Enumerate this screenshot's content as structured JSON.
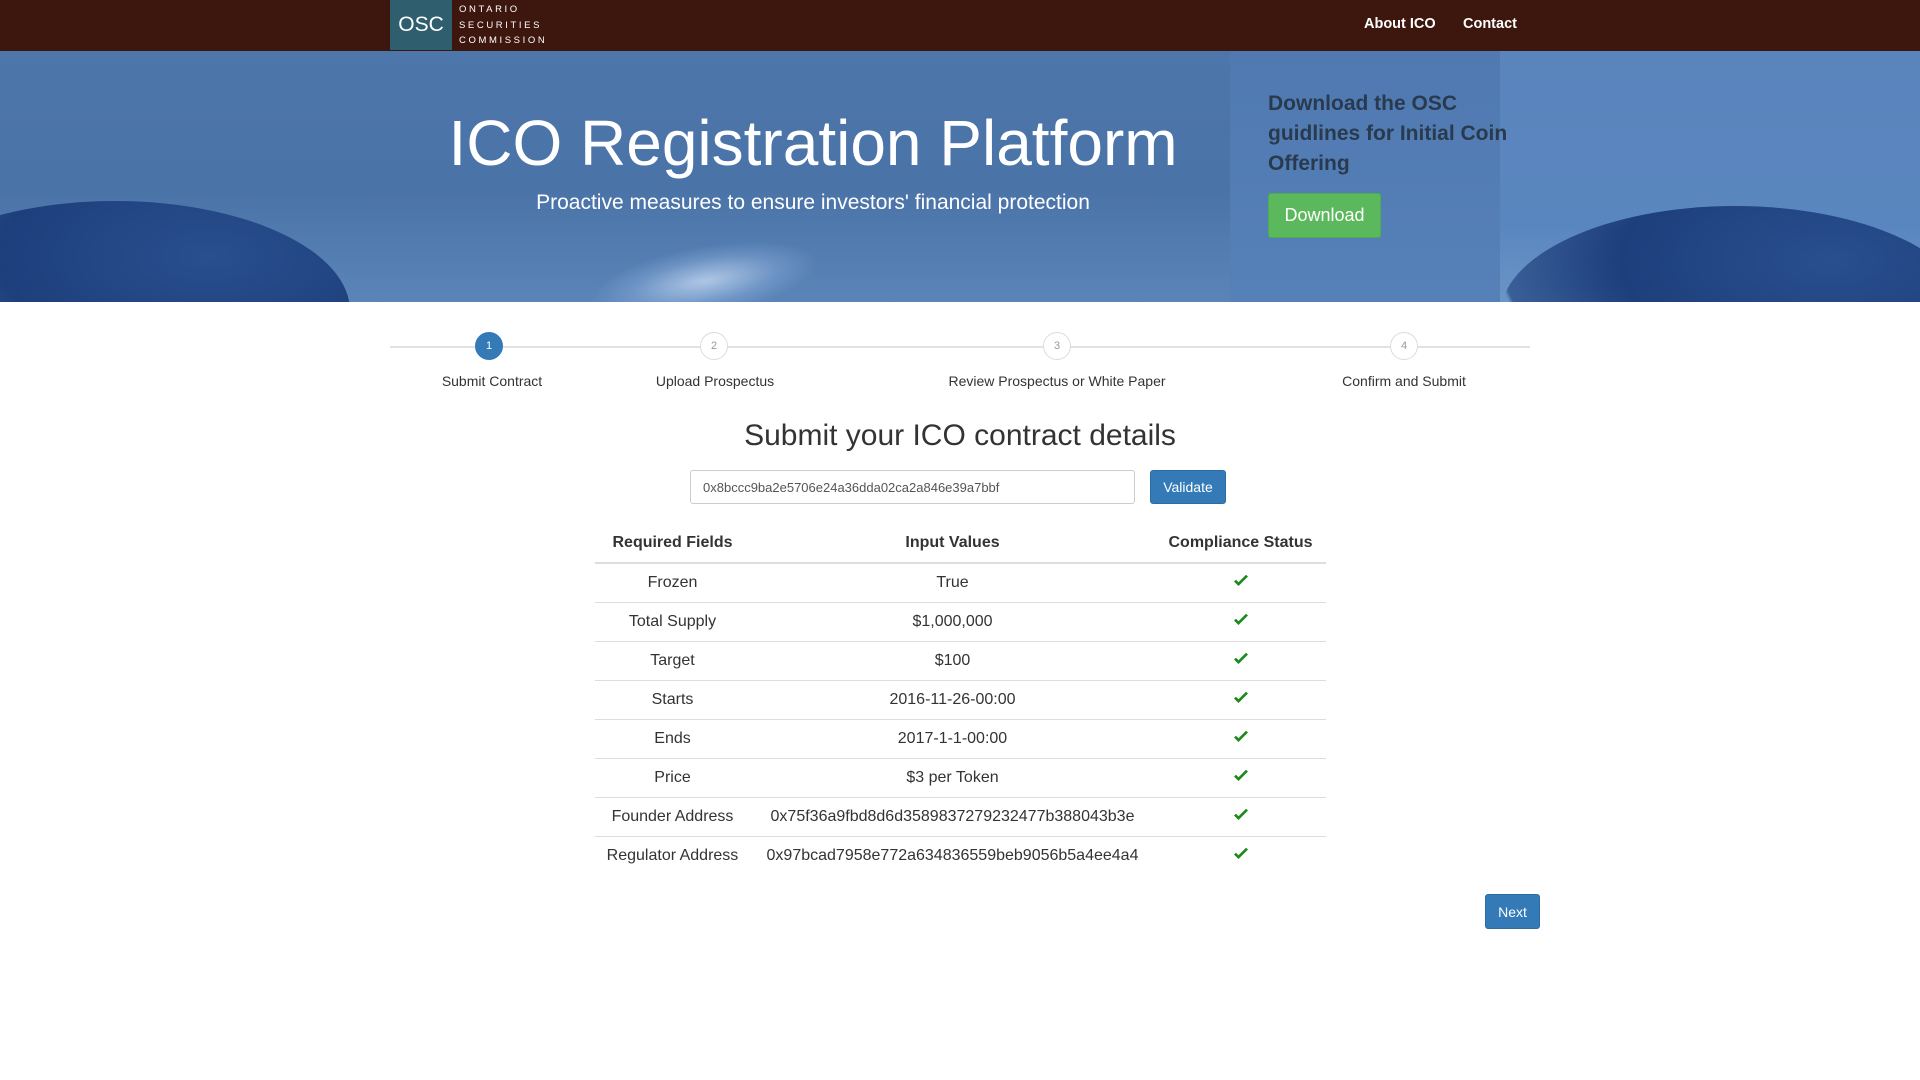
{
  "nav": {
    "logo_abbr": "OSC",
    "logo_lines": [
      "ONTARIO",
      "SECURITIES",
      "COMMISSION"
    ],
    "links": [
      "About ICO",
      "Contact"
    ]
  },
  "hero": {
    "title": "ICO Registration Platform",
    "subtitle": "Proactive measures to ensure investors' financial protection",
    "download_heading": "Download the OSC guidlines for Initial Coin Offering",
    "download_button": "Download"
  },
  "steps": [
    {
      "number": "1",
      "label": "Submit Contract",
      "active": true
    },
    {
      "number": "2",
      "label": "Upload Prospectus",
      "active": false
    },
    {
      "number": "3",
      "label": "Review Prospectus or White Paper",
      "active": false
    },
    {
      "number": "4",
      "label": "Confirm and Submit",
      "active": false
    }
  ],
  "form": {
    "title": "Submit your ICO contract details",
    "contract_address": "0x8bccc9ba2e5706e24a36dda02ca2a846e39a7bbf",
    "validate_button": "Validate"
  },
  "table": {
    "headers": [
      "Required Fields",
      "Input Values",
      "Compliance Status"
    ],
    "rows": [
      {
        "field": "Frozen",
        "value": "True",
        "status": "check-icon"
      },
      {
        "field": "Total Supply",
        "value": "$1,000,000",
        "status": "check-icon"
      },
      {
        "field": "Target",
        "value": "$100",
        "status": "check-icon"
      },
      {
        "field": "Starts",
        "value": "2016-11-26-00:00",
        "status": "check-icon"
      },
      {
        "field": "Ends",
        "value": "2017-1-1-00:00",
        "status": "check-icon"
      },
      {
        "field": "Price",
        "value": "$3 per Token",
        "status": "check-icon"
      },
      {
        "field": "Founder Address",
        "value": "0x75f36a9fbd8d6d3589837279232477b388043b3e",
        "status": "check-icon"
      },
      {
        "field": "Regulator Address",
        "value": "0x97bcad7958e772a634836559beb9056b5a4ee4a4",
        "status": "check-icon"
      }
    ]
  },
  "next_button": "Next",
  "colors": {
    "nav_bg": "#3d160d",
    "primary": "#337ab7",
    "success": "#5cb85c",
    "check": "#1a8a1a"
  }
}
